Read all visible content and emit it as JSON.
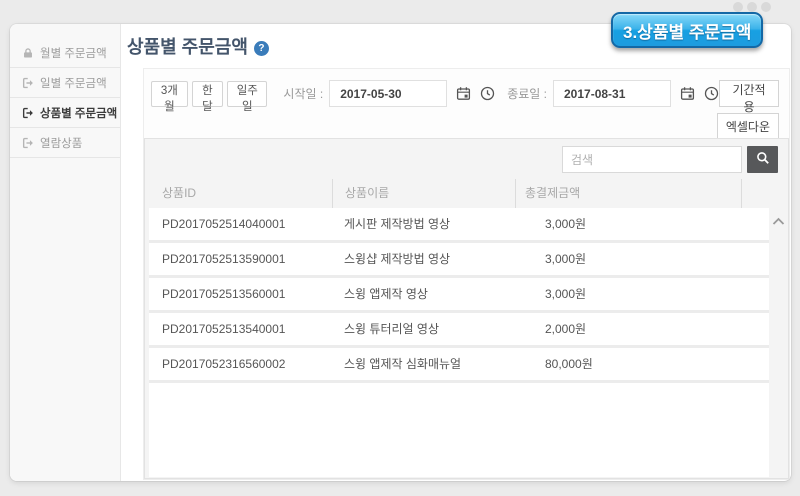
{
  "badge": {
    "label": "3.상품별 주문금액"
  },
  "sidebar": {
    "items": [
      {
        "label": "월별 주문금액",
        "icon": "lock-icon",
        "active": false
      },
      {
        "label": "일별 주문금액",
        "icon": "sign-out-icon",
        "active": false
      },
      {
        "label": "상품별 주문금액",
        "icon": "sign-out-icon",
        "active": true
      },
      {
        "label": "열람상품",
        "icon": "sign-out-icon",
        "active": false
      }
    ]
  },
  "header": {
    "title": "상품별 주문금액",
    "help_glyph": "?"
  },
  "filters": {
    "periods": [
      {
        "label": "3개월"
      },
      {
        "label": "한달"
      },
      {
        "label": "일주일"
      }
    ],
    "start": {
      "label": "시작일 :",
      "value": "2017-05-30"
    },
    "end": {
      "label": "종료일 :",
      "value": "2017-08-31"
    },
    "apply_label": "기간적용",
    "excel_label": "엑셀다운"
  },
  "search": {
    "placeholder": "검색"
  },
  "table": {
    "columns": [
      {
        "label": "상품ID"
      },
      {
        "label": "상품이름"
      },
      {
        "label": "총결제금액"
      }
    ],
    "rows": [
      {
        "id": "PD2017052514040001",
        "name": "게시판 제작방법 영상",
        "amount": "3,000원"
      },
      {
        "id": "PD2017052513590001",
        "name": "스윙샵 제작방법 영상",
        "amount": "3,000원"
      },
      {
        "id": "PD2017052513560001",
        "name": "스윙 앱제작 영상",
        "amount": "3,000원"
      },
      {
        "id": "PD2017052513540001",
        "name": "스윙 튜터리얼 영상",
        "amount": "2,000원"
      },
      {
        "id": "PD2017052316560002",
        "name": "스윙 앱제작 심화매뉴얼",
        "amount": "80,000원"
      }
    ]
  },
  "colors": {
    "badge_blue": "#2fa7e4",
    "badge_border": "#1468a5",
    "help_blue": "#3a7cba",
    "title_text": "#44556b",
    "search_button_bg": "#57585a",
    "page_background": "#ebebeb"
  }
}
